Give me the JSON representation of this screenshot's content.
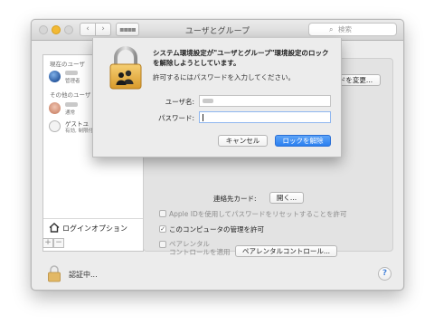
{
  "window": {
    "title": "ユーザとグループ",
    "search_placeholder": "検索",
    "nav_back": "‹",
    "nav_forward": "›",
    "grid": "▪▪▪▪",
    "traffic_colors": {
      "close": "#d6d6d6",
      "minimize": "#f2b935",
      "zoom": "#d6d6d6"
    }
  },
  "sidebar": {
    "current_user_header": "現在のユーザ",
    "current_user_role": "管理者",
    "other_users_header": "その他のユーザ",
    "other_user_role": "通常",
    "guest_name": "ゲストユ",
    "guest_status": "有効, 制限付",
    "login_options_label": "ログインオプション",
    "add_label": "+",
    "remove_label": "−"
  },
  "panel": {
    "change_password_button": "ドを変更...",
    "contact_card_label": "連絡先カード:",
    "contact_card_button": "開く...",
    "apple_id_reset_label": "Apple IDを使用してパスワードをリセットすることを許可",
    "allow_admin_label": "このコンピュータの管理を許可",
    "allow_admin_checked": true,
    "parental_line1": "ペアレンタル",
    "parental_line2": "コントロールを適用",
    "parental_button": "ペアレンタルコントロール..."
  },
  "footer": {
    "auth_label": "認証中...",
    "help_label": "?"
  },
  "dialog": {
    "title": "システム環境設定が\"ユーザとグループ\"環境設定のロックを解除しようとしています。",
    "message": "許可するにはパスワードを入力してください。",
    "username_label": "ユーザ名:",
    "username_value": "",
    "password_label": "パスワード:",
    "password_value": "",
    "cancel_button": "キャンセル",
    "unlock_button": "ロックを解除",
    "accent_color": "#2a7ff0"
  }
}
